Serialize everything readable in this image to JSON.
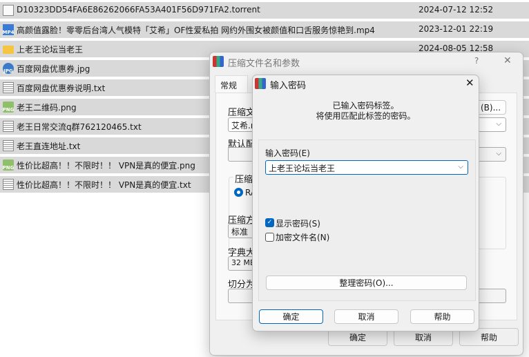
{
  "files": [
    {
      "name": "D10323DD54FA6E86262066FA53A401F56D971FA2.torrent",
      "date": "2024-07-12 12:52",
      "icon": "file-icon",
      "badge": ""
    },
    {
      "name": "高颜值露脸！零零后台湾人气模特「艾希」OF性爱私拍 网约外围女被颜值和口舌服务惊艳到.mp4",
      "date": "2023-12-01 22:19",
      "icon": "video-file-icon",
      "badge": "MP4"
    },
    {
      "name": "上老王论坛当老王",
      "date": "2024-08-05 12:58",
      "icon": "folder-icon",
      "badge": ""
    },
    {
      "name": "百度网盘优惠券.jpg",
      "date": "",
      "icon": "image-file-icon",
      "badge": "JPG"
    },
    {
      "name": "百度网盘优惠券说明.txt",
      "date": "",
      "icon": "text-file-icon",
      "badge": ""
    },
    {
      "name": "老王二维码.png",
      "date": "",
      "icon": "image-file-icon",
      "badge": "PNG"
    },
    {
      "name": "老王日常交流q群762120465.txt",
      "date": "",
      "icon": "text-file-icon",
      "badge": ""
    },
    {
      "name": "老王直连地址.txt",
      "date": "",
      "icon": "text-file-icon",
      "badge": ""
    },
    {
      "name": "性价比超高！！不限时！！ VPN是真的便宜.png",
      "date": "",
      "icon": "image-file-icon",
      "badge": "PNG"
    },
    {
      "name": "性价比超高！！不限时！！ VPN是真的便宜.txt",
      "date": "",
      "icon": "text-file-icon",
      "badge": ""
    }
  ],
  "archive_dialog": {
    "title": "压缩文件名和参数",
    "help": "?",
    "close": "✕",
    "tab": "常规",
    "archive_name_label": "压缩文",
    "archive_name_value": "艾希.r",
    "browse": "(B)...",
    "profile_label": "默认配",
    "format_group": "压缩文",
    "format_radio": "RA",
    "method_label": "压缩方",
    "method_value": "标准",
    "dict_label": "字典大",
    "dict_value": "32 MB",
    "split_label": "切分为",
    "ok": "确定",
    "cancel": "取消",
    "help_btn": "帮助"
  },
  "password_dialog": {
    "title": "输入密码",
    "close": "✕",
    "message_line1": "已输入密码标签。",
    "message_line2": "将使用匹配此标签的密码。",
    "password_label": "输入密码(E)",
    "password_value": "上老王论坛当老王",
    "show_password": "显示密码(S)",
    "show_password_checked": true,
    "encrypt_names": "加密文件名(N)",
    "encrypt_names_checked": false,
    "organize": "整理密码(O)...",
    "ok": "确定",
    "cancel": "取消",
    "help": "帮助"
  },
  "colors": {
    "accent": "#0067c0",
    "row_bg": "#d9d9d9",
    "dialog_bg": "#f0f0f0"
  }
}
